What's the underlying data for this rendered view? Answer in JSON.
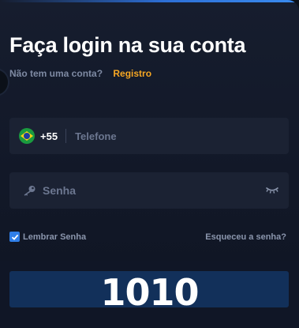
{
  "header": {
    "title": "Faça login na sua conta",
    "no_account_text": "Não tem uma conta?",
    "register_link": "Registro"
  },
  "phone": {
    "country_flag": "flag-brazil-icon",
    "country_code": "+55",
    "placeholder": "Telefone",
    "value": ""
  },
  "password": {
    "icon": "key-icon",
    "placeholder": "Senha",
    "value": "",
    "toggle_icon": "eye-closed-icon"
  },
  "options": {
    "remember_label": "Lembrar Senha",
    "remember_checked": true,
    "forgot_link": "Esqueceu a senha?"
  },
  "submit": {
    "label": "",
    "overlay_text": "1010"
  },
  "colors": {
    "accent": "#f5a623",
    "checkbox": "#2f7ee8",
    "button": "#12305a"
  }
}
